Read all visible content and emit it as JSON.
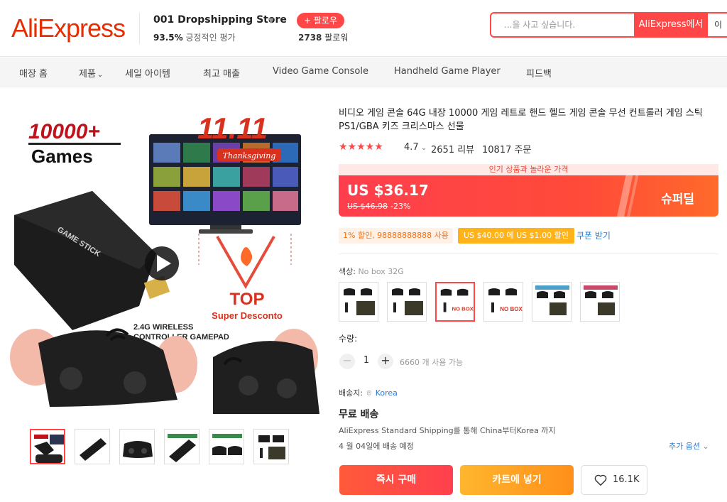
{
  "header": {
    "logo": "AliExpress",
    "store_name": "001 Dropshipping Store",
    "rating_percent": "93.5%",
    "rating_text": "긍정적인 평가",
    "follow_label": "+ 팔로우",
    "followers_count": "2738",
    "followers_label": "팔로워",
    "search_placeholder": "...을 사고 싶습니다.",
    "search_button": "AliExpress에서",
    "search_ext": "이"
  },
  "nav": {
    "items": [
      "매장 홈",
      "제품",
      "세일 아이템",
      "최고 매출",
      "Video Game Console",
      "Handheld Game Player",
      "피드백"
    ]
  },
  "gallery": {
    "banner_games": "10000+",
    "banner_games_word": "Games",
    "banner_sale": "11.11",
    "banner_thanks": "Thanksgiving",
    "banner_top": "TOP",
    "banner_desconto": "Super Desconto",
    "banner_wireless_1": "2.4G  WIRELESS",
    "banner_wireless_2": "CONTROLLER GAMEPAD",
    "stick_text": "GAME STICK"
  },
  "product": {
    "title": "비디오 게임 콘솔 64G 내장 10000 게임 레트로 핸드 헬드 게임 콘솔 무선 컨트롤러 게임 스틱 PS1/GBA 키즈 크리스마스 선물",
    "stars": "★★★★★",
    "rating": "4.7",
    "reviews": "2651 리뷰",
    "orders": "10817 주문"
  },
  "price": {
    "promo_banner": "인기 상품과 놀라운 가격",
    "current": "US $36.17",
    "original": "US $46.98",
    "discount": "-23%",
    "superdeal": "슈퍼딜"
  },
  "coupons": {
    "store_coupon": "1% 할인, 98888888888 사용",
    "coupon_offer": "US $40.00 에 US $1.00 할인",
    "get_coupon": "쿠폰 받기"
  },
  "variants": {
    "label": "색상:",
    "selected_value": "No box 32G",
    "no_box_tag": "NO BOX"
  },
  "quantity": {
    "label": "수량:",
    "minus": "−",
    "value": "1",
    "plus": "+",
    "available": "6660 개 사용 가능"
  },
  "shipping": {
    "to_label": "배송지:",
    "to_value": "Korea",
    "free": "무료 배송",
    "via": "AliExpress Standard Shipping를 통해 China부터Korea 까지",
    "date": "4 월 04일에 배송 예정",
    "more_options": "추가 옵션"
  },
  "actions": {
    "buy_now": "즉시 구매",
    "add_to_cart": "카트에 넣기",
    "wishlist_count": "16.1K"
  },
  "colors": {
    "brand": "#e62e04",
    "accent": "#ff4747",
    "cart": "#ff9f1a",
    "link": "#2e7ad0"
  }
}
